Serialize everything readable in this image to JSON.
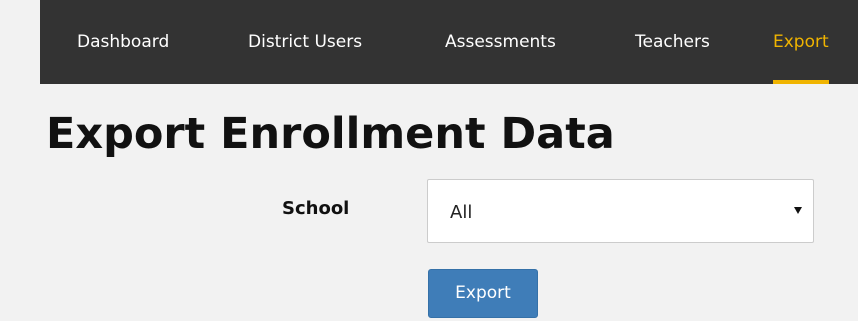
{
  "nav": {
    "items": [
      {
        "label": "Dashboard",
        "active": false
      },
      {
        "label": "District Users",
        "active": false
      },
      {
        "label": "Assessments",
        "active": false
      },
      {
        "label": "Teachers",
        "active": false
      },
      {
        "label": "Export",
        "active": true
      }
    ]
  },
  "page": {
    "title": "Export Enrollment Data"
  },
  "form": {
    "school_label": "School",
    "school_value": "All",
    "export_label": "Export"
  },
  "colors": {
    "nav_background": "#333333",
    "nav_active": "#f0b400",
    "button": "#3f7db8",
    "page_background": "#f2f2f2"
  }
}
